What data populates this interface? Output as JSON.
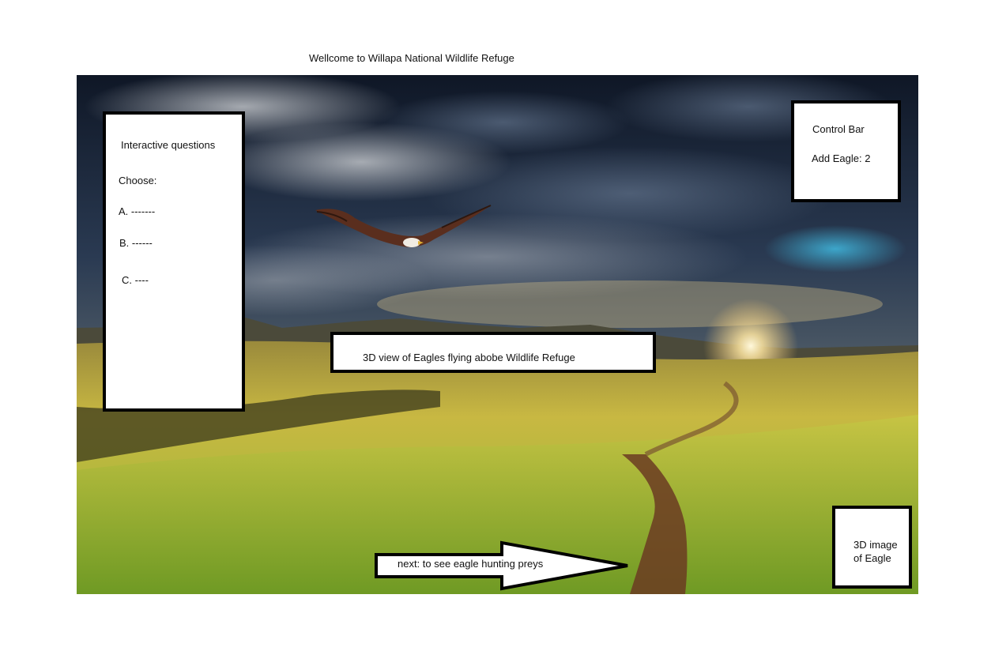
{
  "header": {
    "title": "Wellcome to Willapa National Wildlife Refuge"
  },
  "questions_panel": {
    "title": "Interactive questions",
    "prompt": "Choose:",
    "options": [
      "A. -------",
      "B. ------",
      "C. ----"
    ]
  },
  "control_bar": {
    "title": "Control Bar",
    "add_eagle": "Add Eagle: 2"
  },
  "scene": {
    "view_label": "3D view of Eagles flying abobe Wildlife Refuge",
    "background_icon": "landscape-sunset-photo",
    "bird_icon": "flying-eagle-icon"
  },
  "eagle_image_panel": {
    "label": "3D image\nof Eagle"
  },
  "next_button": {
    "label": "next: to see eagle hunting preys",
    "icon": "right-arrow-icon"
  },
  "colors": {
    "sky_dark": "#141d2e",
    "grass": "#b8b13a",
    "sun": "#fff6d2",
    "border": "#000000"
  }
}
